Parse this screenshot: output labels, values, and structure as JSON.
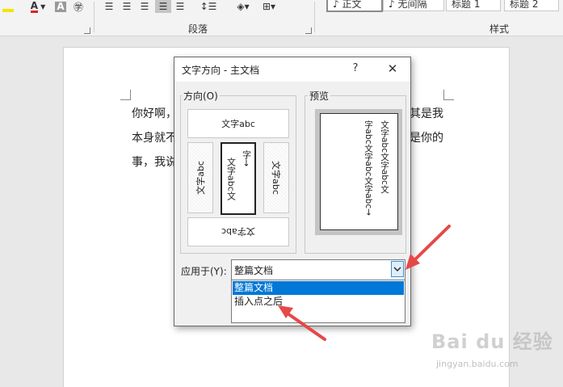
{
  "ribbon": {
    "font_color_glyph": "A",
    "highlight_glyph": "A",
    "phonetic_glyph": "㊫",
    "groups": {
      "paragraph": "段落",
      "styles": "样式"
    },
    "styles": [
      "♪ 正文",
      "♪ 无间隔",
      "标题 1",
      "标题 2"
    ]
  },
  "document": {
    "lines": [
      "你好啊，",
      "本身就不",
      "事，我说"
    ],
    "right_fragments": [
      "其是我",
      "是你的"
    ]
  },
  "dialog": {
    "title": "文字方向 - 主文档",
    "help": "?",
    "close": "✕",
    "orientation_label": "方向(O)",
    "orientation_hotkey": "O",
    "preview_label": "预览",
    "options": {
      "horizontal": "文字abc",
      "rotated_left": "文字abc",
      "vertical_stacked_a": "字→",
      "vertical_stacked_b": "文字abc文",
      "rotated_right": "文字abc",
      "upside_down": "文字abc"
    },
    "preview_columns": [
      "文字abc文字abc文",
      "字abc文字abc文字abc→"
    ],
    "apply_label": "应用于(Y):",
    "apply_value": "整篇文档",
    "dropdown_items": [
      "整篇文档",
      "插入点之后"
    ],
    "selected_option": "vertical_stacked"
  },
  "colors": {
    "accent": "#0078d7",
    "arrow": "#e64848"
  },
  "watermark": {
    "brand": "Bai du 经验",
    "site": "jingyan.baidu.com"
  }
}
